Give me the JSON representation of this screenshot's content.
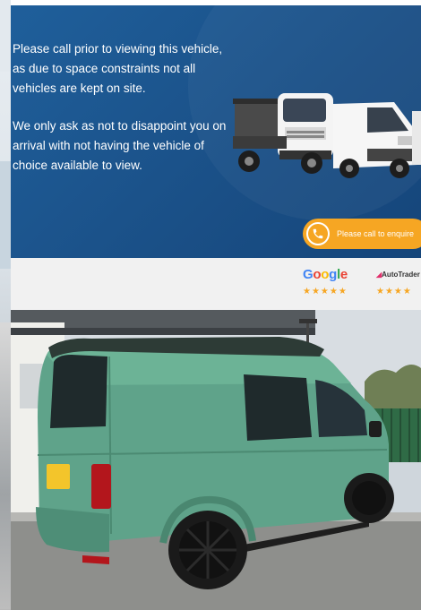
{
  "banner": {
    "notice_p1": "Please call prior to viewing this vehicle, as due to space constraints not all vehicles are kept on site.",
    "notice_p2": "We only ask as not to disappoint you on arrival with not having the vehicle of choice available to view.",
    "cta_label": "Please call to enquire",
    "colors": {
      "background": "#1a4f86",
      "cta": "#f6a623"
    }
  },
  "ratings": {
    "google": "Google",
    "google_stars": "★★★★★",
    "autotrader": "AutoTrader",
    "autotrader_stars": "★★★★"
  },
  "photo": {
    "subject": "green-camper-van",
    "colors": {
      "van": "#5fa38a",
      "building": "#f1f1ee",
      "sky": "#d8dde2"
    }
  },
  "icons": [
    "phone-icon",
    "truck-icon",
    "van-icon"
  ]
}
